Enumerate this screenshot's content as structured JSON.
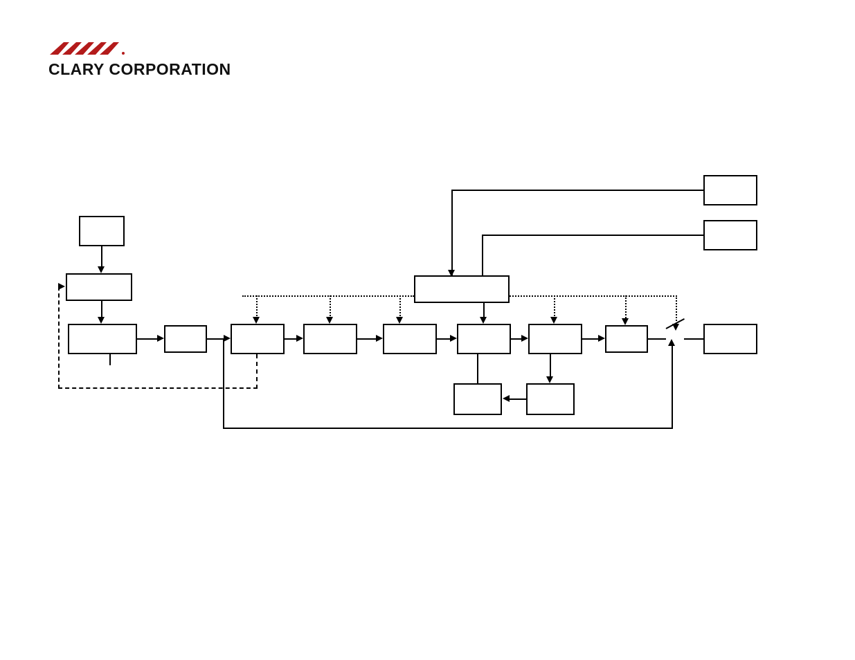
{
  "logo": {
    "company_text": "CLARY CORPORATION",
    "brand_color": "#b31b1b",
    "mark_alt": "Clary stylized mark"
  },
  "diagram": {
    "boxes": {
      "ac_in": "",
      "emi_filter": "",
      "rectifier_pfc": "",
      "bus_caps": "",
      "inverter_a": "",
      "inverter_b": "",
      "tx": "",
      "dc_bus": "",
      "output_stage": "",
      "output_relay": "",
      "out_conn": "",
      "controller": "",
      "comm": "",
      "hmi": "",
      "battery": "",
      "charger": ""
    }
  }
}
